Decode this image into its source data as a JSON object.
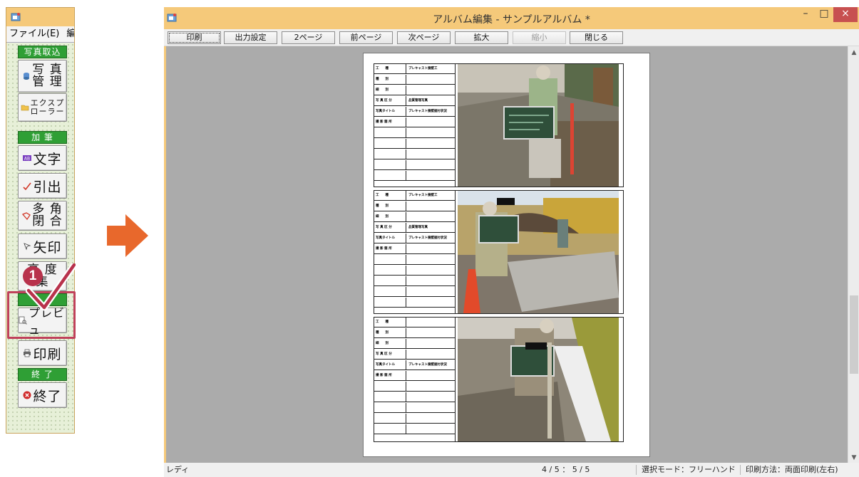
{
  "left_panel": {
    "menu": [
      "ファイル(E)",
      "編"
    ],
    "groups": {
      "photo_import": "写真取込",
      "add": "加 筆",
      "end": "終 了"
    },
    "buttons": {
      "photo_mgmt": [
        "写 真",
        "管 理"
      ],
      "explorer": [
        "エクスプ",
        "ローラー"
      ],
      "text": "文字",
      "leader": "引出",
      "polygon": [
        "多 角",
        "閉 合"
      ],
      "arrow": "矢印",
      "altitude": [
        "高 度",
        "集"
      ],
      "preview": "プレビュ",
      "print": "印刷",
      "quit": "終了"
    },
    "step_badge": "1"
  },
  "window": {
    "title": "アルバム編集 - サンプルアルバム *",
    "controls": {
      "minimize": "–",
      "maximize": "□",
      "close": "×"
    },
    "toolbar": [
      "印刷",
      "出力設定",
      "2ページ",
      "前ページ",
      "次ページ",
      "拡大",
      "縮小",
      "閉じる"
    ],
    "status": {
      "ready": "レディ",
      "page_info": "4 / 5 ： 5 / 5",
      "select_mode": "選択モード：フリーハンド",
      "print_method": "印刷方法：両面印刷(左右)"
    }
  },
  "page": {
    "records": [
      {
        "fields": [
          [
            "工　　種",
            "プレキャスト擁壁工"
          ],
          [
            "種　　別",
            ""
          ],
          [
            "細　　別",
            ""
          ],
          [
            "写 真 区 分",
            "品質管理写真"
          ],
          [
            "写真タイトル",
            "プレキャスト擁壁据付状況"
          ],
          [
            "撮 影 箇 所",
            ""
          ]
        ]
      },
      {
        "fields": [
          [
            "工　　種",
            "プレキャスト擁壁工"
          ],
          [
            "種　　別",
            ""
          ],
          [
            "細　　別",
            ""
          ],
          [
            "写 真 区 分",
            "品質管理写真"
          ],
          [
            "写真タイトル",
            "プレキャスト擁壁据付状況"
          ],
          [
            "撮 影 箇 所",
            ""
          ]
        ]
      },
      {
        "fields": [
          [
            "工　　種",
            ""
          ],
          [
            "種　　別",
            ""
          ],
          [
            "細　　別",
            ""
          ],
          [
            "写 真 区 分",
            ""
          ],
          [
            "写真タイトル",
            "プレキャスト擁壁据付状況"
          ],
          [
            "撮 影 箇 所",
            ""
          ]
        ]
      }
    ]
  },
  "colors": {
    "accent_green": "#2f9f35",
    "highlight": "#c0415a",
    "arrow": "#e8682c",
    "frame": "#f5c97a"
  }
}
